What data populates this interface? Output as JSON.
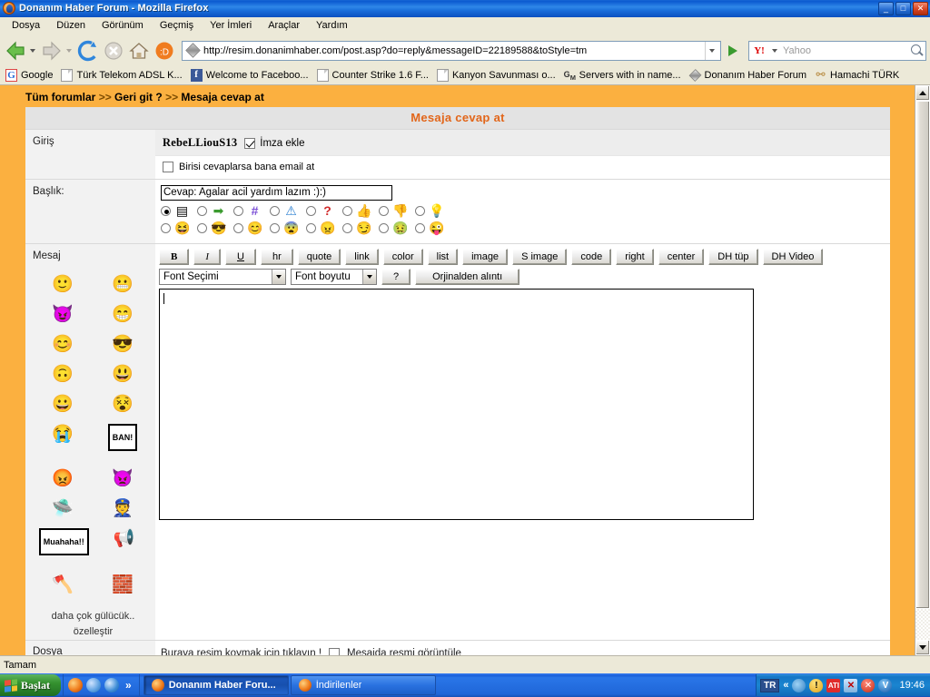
{
  "window": {
    "title": "Donanım Haber Forum - Mozilla Firefox",
    "icon": "firefox-icon",
    "minimize": "_",
    "maximize": "□",
    "close": "✕"
  },
  "menubar": {
    "items": [
      {
        "label": "Dosya"
      },
      {
        "label": "Düzen"
      },
      {
        "label": "Görünüm"
      },
      {
        "label": "Geçmiş"
      },
      {
        "label": "Yer İmleri"
      },
      {
        "label": "Araçlar"
      },
      {
        "label": "Yardım"
      }
    ]
  },
  "navbar": {
    "back_icon": "back-arrow-icon",
    "forward_icon": "forward-arrow-icon",
    "reload_icon": "reload-icon",
    "stop_icon": "stop-icon",
    "home_icon": "home-icon",
    "dh_icon": "donanimhaber-icon",
    "url": "http://resim.donanimhaber.com/post.asp?do=reply&messageID=22189588&toStyle=tm",
    "go_icon": "go-arrow-icon",
    "search_engine": "Y!",
    "search_placeholder": "Yahoo",
    "search_value": "",
    "search_icon": "magnifier-icon"
  },
  "bookmarks": [
    {
      "label": "Google",
      "icon": "google-icon"
    },
    {
      "label": "Türk Telekom ADSL K...",
      "icon": "page-icon"
    },
    {
      "label": "Welcome to Faceboo...",
      "icon": "facebook-icon"
    },
    {
      "label": "Counter Strike 1.6 F...",
      "icon": "page-icon"
    },
    {
      "label": "Kanyon Savunması o...",
      "icon": "page-icon"
    },
    {
      "label": "Servers with in name...",
      "icon": "gamemonitor-icon"
    },
    {
      "label": "Donanım Haber Forum",
      "icon": "donanimhaber-icon"
    },
    {
      "label": "Hamachi TÜRK",
      "icon": "hamachi-icon"
    }
  ],
  "page": {
    "breadcrumb": {
      "all_forums": "Tüm forumlar",
      "sep1": ">>",
      "back": "Geri git ?",
      "sep2": ">>",
      "current": "Mesaja cevap at"
    },
    "form_title": "Mesaja cevap at",
    "rows": {
      "login_label": "Giriş",
      "username": "RebeLLiouS13",
      "signature_checkbox_label": "İmza ekle",
      "signature_checked": true,
      "email_checkbox_label": "Birisi cevaplarsa bana email at",
      "email_checked": false,
      "title_label": "Başlık:",
      "title_value": "Cevap: Agalar acil yardım lazım :):)",
      "message_label": "Mesaj",
      "file_label": "Dosya",
      "file_hint": "Buraya resim koymak için tıklayın !",
      "file_checkbox_label": "Mesajda resmi görüntüle",
      "file_checked": false
    },
    "icon_radio_rows": [
      [
        {
          "icon": "list-note-icon",
          "glyph": "▤",
          "selected": true
        },
        {
          "icon": "green-arrow-icon",
          "glyph": "➡",
          "selected": false
        },
        {
          "icon": "hash-icon",
          "glyph": "#",
          "selected": false
        },
        {
          "icon": "warning-icon",
          "glyph": "⚠",
          "selected": false
        },
        {
          "icon": "question-icon",
          "glyph": "?",
          "selected": false
        },
        {
          "icon": "thumbs-up-icon",
          "glyph": "👍",
          "selected": false
        },
        {
          "icon": "thumbs-down-icon",
          "glyph": "👎",
          "selected": false
        },
        {
          "icon": "idea-bulb-icon",
          "glyph": "💡",
          "selected": false
        }
      ],
      [
        {
          "icon": "laughing-smiley-icon",
          "glyph": "😆",
          "selected": false
        },
        {
          "icon": "cool-sunglasses-smiley-icon",
          "glyph": "😎",
          "selected": false
        },
        {
          "icon": "happy-smiley-icon",
          "glyph": "😊",
          "selected": false
        },
        {
          "icon": "blue-smiley-icon",
          "glyph": "😨",
          "selected": false
        },
        {
          "icon": "angry-smiley-icon",
          "glyph": "😠",
          "selected": false
        },
        {
          "icon": "smirk-smiley-icon",
          "glyph": "😏",
          "selected": false
        },
        {
          "icon": "sick-green-smiley-icon",
          "glyph": "🤢",
          "selected": false
        },
        {
          "icon": "wink-smiley-icon",
          "glyph": "😜",
          "selected": false
        }
      ]
    ],
    "toolbar_buttons": [
      "B",
      "I",
      "U",
      "hr",
      "quote",
      "link",
      "color",
      "list",
      "image",
      "S image",
      "code",
      "right",
      "center",
      "DH tüp",
      "DH Video"
    ],
    "font_select": "Font Seçimi",
    "size_select": "Font boyutu",
    "help_button": "?",
    "quote_original_button": "Orjinalden alıntı",
    "message_value": "",
    "smiley_palette": [
      [
        {
          "icon": "smile-icon",
          "glyph": "🙂"
        },
        {
          "icon": "grin-teeth-icon",
          "glyph": "😬"
        }
      ],
      [
        {
          "icon": "devil-smiley-icon",
          "glyph": "😈"
        },
        {
          "icon": "king-crown-smiley-icon",
          "glyph": "😁"
        }
      ],
      [
        {
          "icon": "blush-smiley-icon",
          "glyph": "😊"
        },
        {
          "icon": "sunglasses-laugh-icon",
          "glyph": "😎"
        }
      ],
      [
        {
          "icon": "dark-smiley-hand-icon",
          "glyph": "🙃"
        },
        {
          "icon": "thumbs-up-smiley-icon",
          "glyph": "😃"
        }
      ],
      [
        {
          "icon": "pointing-smiley-icon",
          "glyph": "😀"
        },
        {
          "icon": "cannon-smiley-icon",
          "glyph": "😵"
        }
      ],
      [
        {
          "icon": "crying-water-smiley-icon",
          "glyph": "😭"
        },
        {
          "icon": "ban-sign-icon",
          "glyph": "BAN!"
        }
      ],
      [
        {
          "icon": "flame-head-smiley-icon",
          "glyph": "😡"
        },
        {
          "icon": "red-devil-icon",
          "glyph": "👿"
        }
      ],
      [
        {
          "icon": "ufo-smiley-icon",
          "glyph": "🛸"
        },
        {
          "icon": "police-smiley-icon",
          "glyph": "👮"
        }
      ],
      [
        {
          "icon": "muahaha-sign-icon",
          "glyph": "Muahaha!!"
        },
        {
          "icon": "pacman-megaphone-icon",
          "glyph": "📢"
        }
      ],
      [
        {
          "icon": "viking-smiley-icon",
          "glyph": "🪓"
        },
        {
          "icon": "brick-wall-smiley-icon",
          "glyph": "🧱"
        }
      ]
    ],
    "more_smileys": "daha çok gülücük..",
    "customize": "özelleştir"
  },
  "statusbar": {
    "text": "Tamam"
  },
  "taskbar": {
    "start_label": "Başlat",
    "quicklaunch": [
      {
        "icon": "firefox-quicklaunch-icon"
      },
      {
        "icon": "ie-restore-icon"
      },
      {
        "icon": "internet-explorer-icon"
      }
    ],
    "quicklaunch_chevron": "»",
    "tasks": [
      {
        "label": "Donanım Haber Foru...",
        "icon": "firefox-icon",
        "active": true
      },
      {
        "label": "İndirilenler",
        "icon": "firefox-icon",
        "active": false
      }
    ],
    "tray": {
      "language": "TR",
      "chevron": "«",
      "icons": [
        {
          "name": "volume-icon",
          "glyph": ""
        },
        {
          "name": "warning-shield-icon",
          "glyph": "!"
        },
        {
          "name": "ati-catalyst-icon",
          "glyph": "ATI"
        },
        {
          "name": "network-disconnected-icon",
          "glyph": "✕"
        },
        {
          "name": "security-alert-icon",
          "glyph": "✕"
        },
        {
          "name": "antivirus-shield-icon",
          "glyph": "V"
        }
      ],
      "time": "19:46"
    }
  },
  "colors": {
    "page_background": "#fbb040",
    "title_orange": "#e2661a",
    "taskbar_blue": "#1f66d8"
  }
}
